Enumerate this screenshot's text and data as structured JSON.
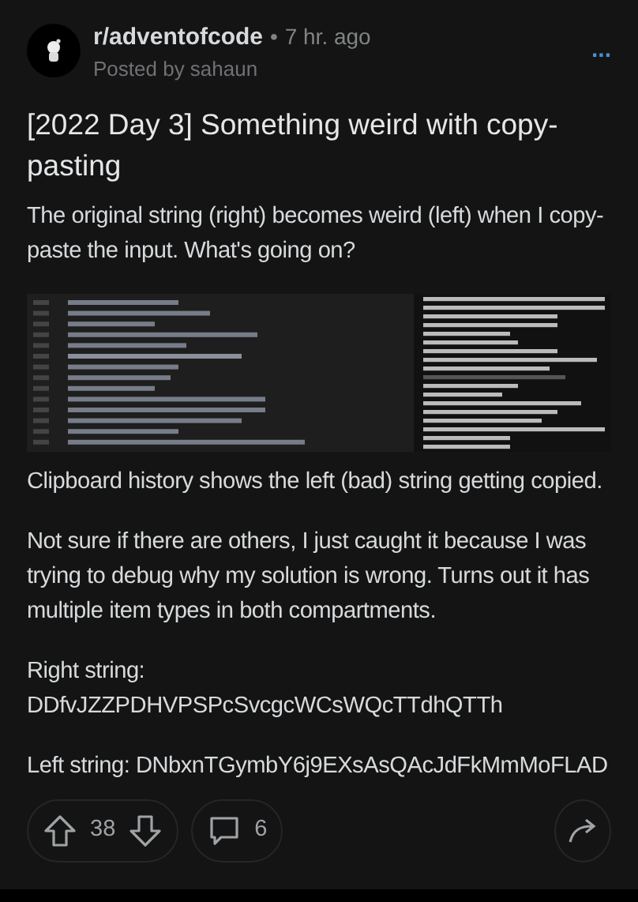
{
  "post": {
    "subreddit": "r/adventofcode",
    "separator": "•",
    "age": "7 hr. ago",
    "author": "Posted by sahaun",
    "menu": "...",
    "title": "[2022 Day 3] Something weird with copy-pasting",
    "intro": "The original string (right) becomes weird (left) when I copy-paste the input. What's going on?",
    "paragraphs": [
      "Clipboard history shows the left (bad) string getting copied.",
      "Not sure if there are others, I just caught it because I was trying to debug why my solution is wrong. Turns out it has multiple item types in both compartments.",
      "Right string: DDfvJZZPDHVPSPcSvcgcWCsWQcTTdhQTTh",
      "Left string: DNbxnTGymbY6j9EXsAsQAcJdFkMmMoFLAD"
    ]
  },
  "actions": {
    "votes": "38",
    "comments": "6"
  }
}
